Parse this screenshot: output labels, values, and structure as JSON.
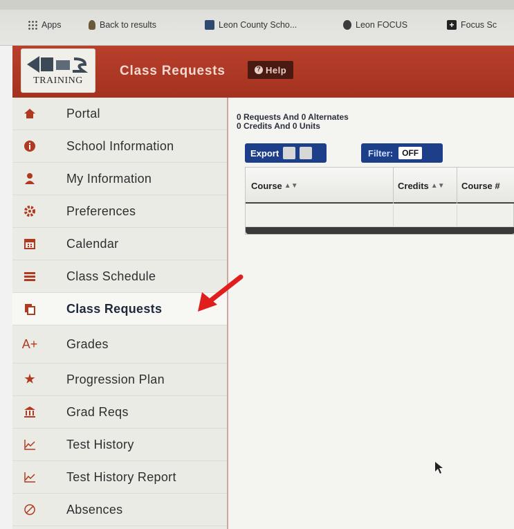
{
  "bookmarks": {
    "items": [
      {
        "label": "Apps",
        "icon": "apps-grid-icon"
      },
      {
        "label": "Back to results",
        "icon": "bookmark-icon"
      },
      {
        "label": "Leon County Scho...",
        "icon": "site-icon"
      },
      {
        "label": "Leon FOCUS",
        "icon": "site-icon"
      },
      {
        "label": "Focus Sc",
        "icon": "plus-icon"
      }
    ]
  },
  "header": {
    "logo_text": "TRAINING",
    "title": "Class Requests",
    "help_label": "Help",
    "accent_color": "#b03a26"
  },
  "sidebar": {
    "items": [
      {
        "label": "Portal",
        "icon": "home-icon"
      },
      {
        "label": "School Information",
        "icon": "info-icon"
      },
      {
        "label": "My Information",
        "icon": "user-icon"
      },
      {
        "label": "Preferences",
        "icon": "gear-icon"
      },
      {
        "label": "Calendar",
        "icon": "calendar-icon"
      },
      {
        "label": "Class Schedule",
        "icon": "list-icon"
      },
      {
        "label": "Class Requests",
        "icon": "copy-icon",
        "active": true
      },
      {
        "label": "Grades",
        "icon": "grade-icon"
      },
      {
        "label": "Progression Plan",
        "icon": "star-icon"
      },
      {
        "label": "Grad Reqs",
        "icon": "building-icon"
      },
      {
        "label": "Test History",
        "icon": "chart-icon"
      },
      {
        "label": "Test History Report",
        "icon": "chart-icon"
      },
      {
        "label": "Absences",
        "icon": "ban-icon"
      }
    ]
  },
  "content": {
    "summary_line1": "0 Requests And 0 Alternates",
    "summary_line2": "0 Credits And 0 Units",
    "export_label": "Export",
    "filter_label": "Filter:",
    "filter_state": "OFF",
    "table": {
      "columns": [
        "Course",
        "Credits",
        "Course #"
      ]
    }
  }
}
